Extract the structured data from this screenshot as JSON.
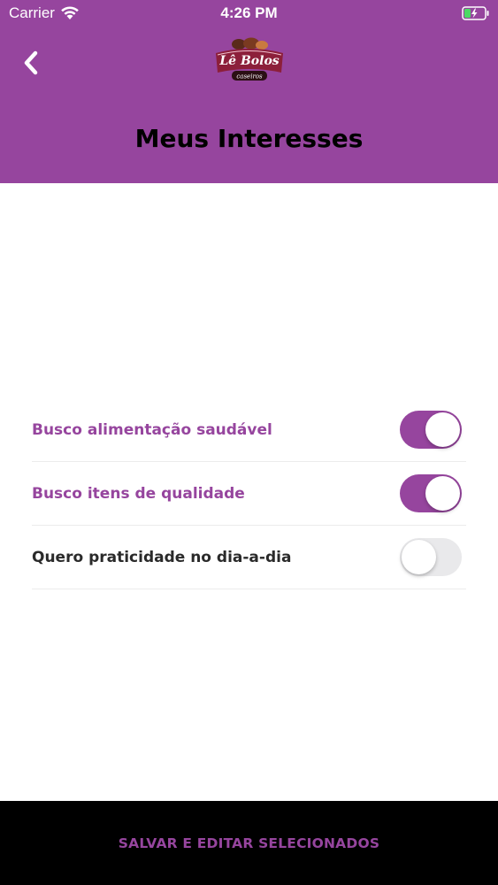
{
  "status_bar": {
    "carrier": "Carrier",
    "time": "4:26 PM",
    "wifi_icon": "wifi-icon",
    "battery_icon": "battery-charging-icon"
  },
  "header": {
    "back_icon": "chevron-left-icon",
    "logo_text": "Lê Bolos",
    "logo_subtext": "caseiros",
    "title": "Meus Interesses",
    "background_color": "#96459e"
  },
  "interests": [
    {
      "label": "Busco alimentação saudável",
      "enabled": true
    },
    {
      "label": "Busco itens de qualidade",
      "enabled": true
    },
    {
      "label": "Quero praticidade no dia-a-dia",
      "enabled": false
    }
  ],
  "footer": {
    "button_label": "SALVAR E EDITAR SELECIONADOS"
  },
  "colors": {
    "accent": "#96459e",
    "footer_bg": "#000000"
  }
}
